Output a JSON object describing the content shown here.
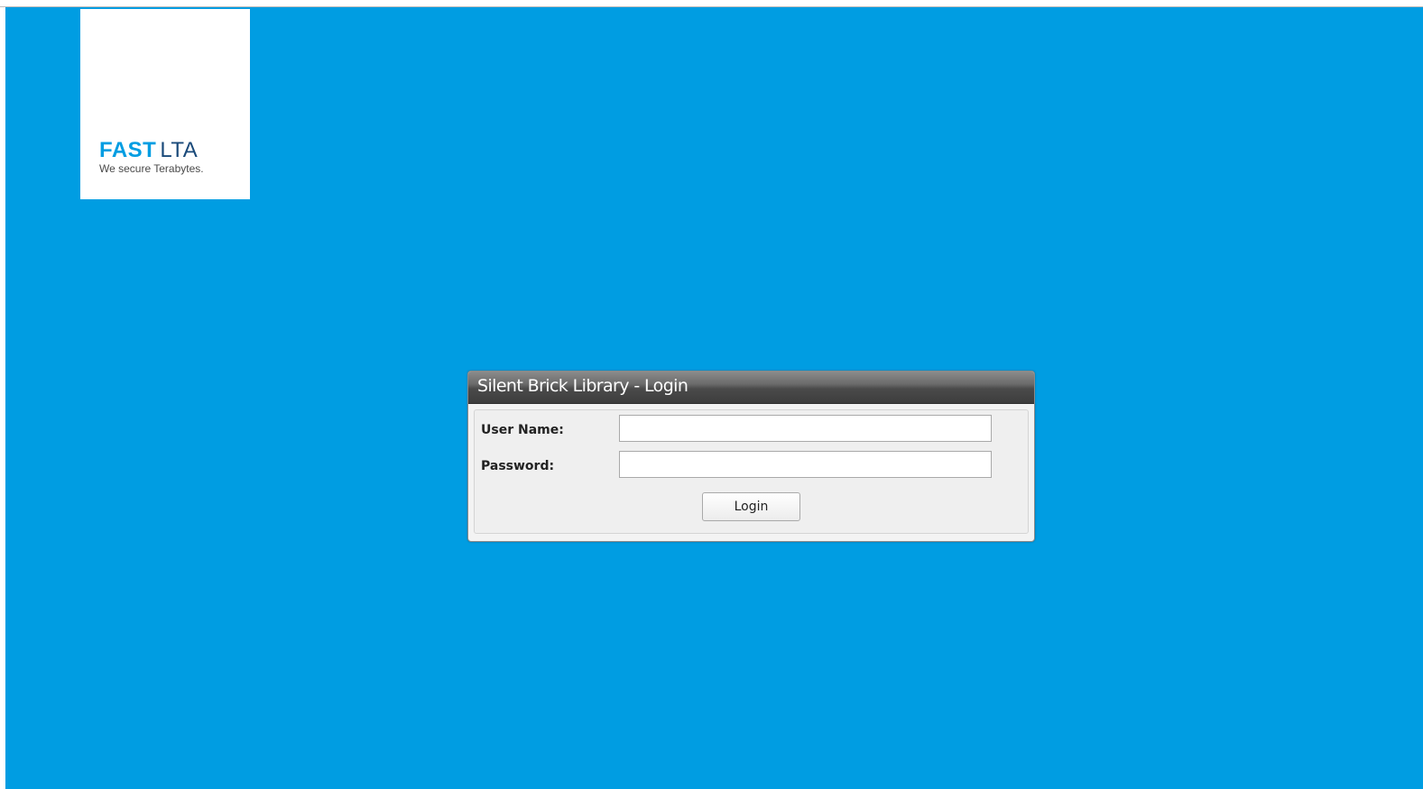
{
  "logo": {
    "brand_primary": "FAST",
    "brand_secondary": "LTA",
    "slogan": "We secure Terabytes."
  },
  "login": {
    "title": "Silent Brick Library - Login",
    "username_label": "User Name:",
    "username_value": "",
    "password_label": "Password:",
    "password_value": "",
    "submit_label": "Login"
  },
  "colors": {
    "background": "#009de2",
    "brand_blue": "#009de2",
    "header_dark": "#4a4a4a"
  }
}
